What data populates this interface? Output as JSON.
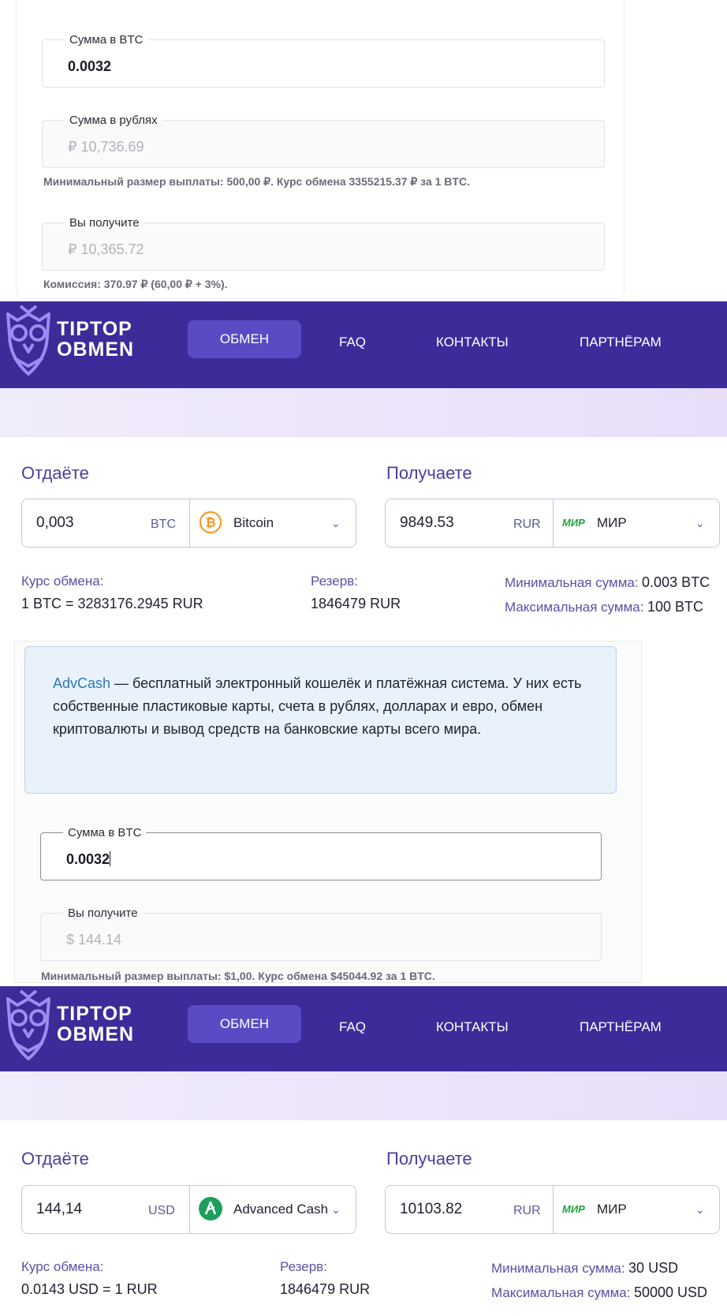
{
  "panel1": {
    "btc_label": "Сумма в BTC",
    "btc_value": "0.0032",
    "rub_label": "Сумма в рублях",
    "rub_value": "₽ 10,736.69",
    "min_hint": "Минимальный размер выплаты: 500,00 ₽. Курс обмена 3355215.37 ₽ за 1 BTC.",
    "receive_label": "Вы получите",
    "receive_value": "₽ 10,365.72",
    "commission": "Комиссия: 370.97 ₽ (60,00 ₽ + 3%)."
  },
  "header": {
    "logo_line1": "TIPTOP",
    "logo_line2": "OBMEN",
    "nav": [
      "ОБМЕН",
      "FAQ",
      "КОНТАКТЫ",
      "ПАРТНЁРАМ"
    ]
  },
  "exchange1": {
    "give_title": "Отдаёте",
    "give_amount": "0,003",
    "give_currency": "BTC",
    "give_name": "Bitcoin",
    "get_title": "Получаете",
    "get_amount": "9849.53",
    "get_currency": "RUR",
    "get_name": "МИР",
    "rate_label": "Курс обмена:",
    "rate_value": "1 BTC = 3283176.2945 RUR",
    "reserve_label": "Резерв:",
    "reserve_value": "1846479 RUR",
    "min_label": "Минимальная сумма:",
    "min_value": "0.003 BTC",
    "max_label": "Максимальная сумма:",
    "max_value": "100 BTC"
  },
  "info": {
    "link": "AdvCash",
    "text": " — бесплатный электронный кошелёк и платёжная система. У них есть собственные пластиковые карты, счета в рублях, долларах и евро, обмен криптовалюты и вывод средств на банковские карты всего мира."
  },
  "panel2": {
    "btc_label": "Сумма в BTC",
    "btc_value": "0.0032",
    "receive_label": "Вы получите",
    "receive_value": "$ 144.14",
    "min_hint": "Минимальный размер выплаты: $1,00. Курс обмена $45044.92 за 1 BTC."
  },
  "exchange2": {
    "give_title": "Отдаёте",
    "give_amount": "144,14",
    "give_currency": "USD",
    "give_name": "Advanced Cash",
    "get_title": "Получаете",
    "get_amount": "10103.82",
    "get_currency": "RUR",
    "get_name": "МИР",
    "rate_label": "Курс обмена:",
    "rate_value": "0.0143 USD = 1 RUR",
    "reserve_label": "Резерв:",
    "reserve_value": "1846479 RUR",
    "min_label": "Минимальная сумма:",
    "min_value": "30 USD",
    "max_label": "Максимальная сумма:",
    "max_value": "50000 USD"
  },
  "mir_logo_text": "МИР",
  "colors": {
    "header_bg": "#3d2b9a",
    "nav_active_bg": "#5a4bc4",
    "accent_text": "#4a3ea0",
    "bitcoin": "#f7931a",
    "advcash": "#1c9e5e",
    "mir_green": "#1fa33c",
    "info_bg": "#e9f2fb",
    "link": "#2a7ab8"
  },
  "icons": [
    "owl-logo-icon",
    "bitcoin-icon",
    "advcash-icon",
    "mir-logo-icon",
    "chevron-down-icon"
  ]
}
